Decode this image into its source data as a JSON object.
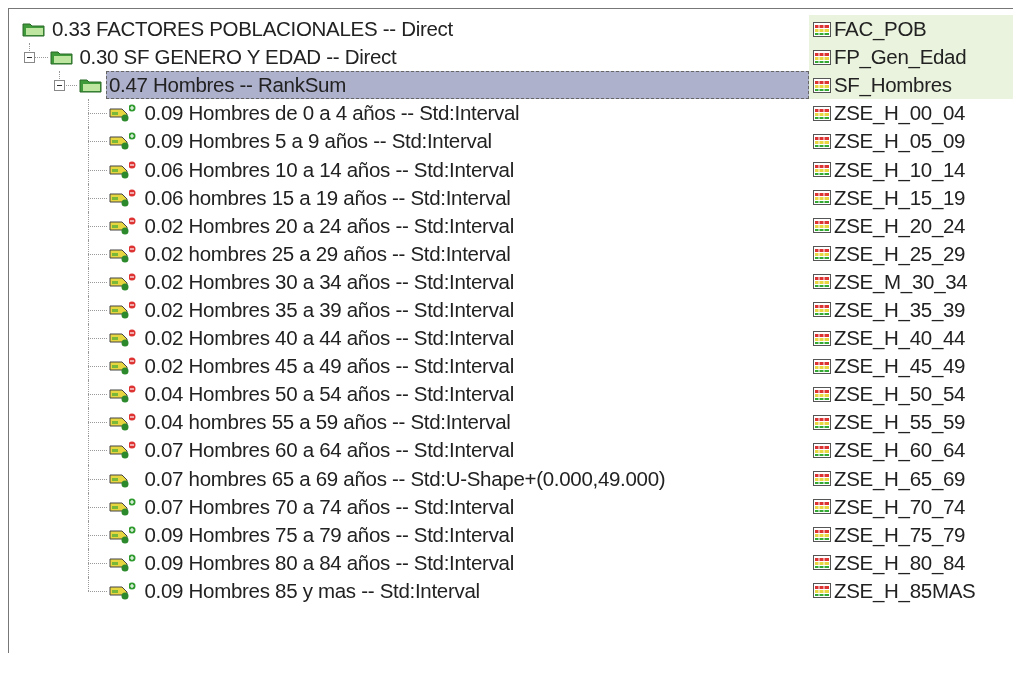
{
  "tree": {
    "label": "0.33 FACTORES POBLACIONALES -- Direct",
    "attribute": "FAC_POB",
    "kind": "group",
    "selected": false,
    "children": [
      {
        "label": "0.30 SF GENERO Y EDAD -- Direct",
        "attribute": "FP_Gen_Edad",
        "kind": "group",
        "selected": false,
        "expanded": true,
        "children": [
          {
            "label": "0.47 Hombres -- RankSum",
            "attribute": "SF_Hombres",
            "kind": "group",
            "selected": true,
            "expanded": true,
            "children": [
              {
                "label": "0.09 Hombres de 0 a 4 años -- Std:Interval",
                "attribute": "ZSE_H_00_04",
                "kind": "increasing",
                "selected": false
              },
              {
                "label": "0.09 Hombres 5 a 9 años -- Std:Interval",
                "attribute": "ZSE_H_05_09",
                "kind": "increasing",
                "selected": false
              },
              {
                "label": "0.06 Hombres 10 a 14 años -- Std:Interval",
                "attribute": "ZSE_H_10_14",
                "kind": "decreasing",
                "selected": false
              },
              {
                "label": "0.06 hombres 15 a 19 años -- Std:Interval",
                "attribute": "ZSE_H_15_19",
                "kind": "decreasing",
                "selected": false
              },
              {
                "label": "0.02 Hombres 20 a 24 años -- Std:Interval",
                "attribute": "ZSE_H_20_24",
                "kind": "decreasing",
                "selected": false
              },
              {
                "label": "0.02 hombres 25 a 29 años -- Std:Interval",
                "attribute": "ZSE_H_25_29",
                "kind": "decreasing",
                "selected": false
              },
              {
                "label": "0.02 Hombres 30 a 34 años -- Std:Interval",
                "attribute": "ZSE_M_30_34",
                "kind": "decreasing",
                "selected": false
              },
              {
                "label": "0.02 Hombres 35 a 39 años -- Std:Interval",
                "attribute": "ZSE_H_35_39",
                "kind": "decreasing",
                "selected": false
              },
              {
                "label": "0.02 Hombres 40 a 44 años -- Std:Interval",
                "attribute": "ZSE_H_40_44",
                "kind": "decreasing",
                "selected": false
              },
              {
                "label": "0.02 Hombres 45 a 49 años -- Std:Interval",
                "attribute": "ZSE_H_45_49",
                "kind": "decreasing",
                "selected": false
              },
              {
                "label": "0.04 Hombres 50 a 54 años -- Std:Interval",
                "attribute": "ZSE_H_50_54",
                "kind": "decreasing",
                "selected": false
              },
              {
                "label": "0.04 hombres 55 a 59 años -- Std:Interval",
                "attribute": "ZSE_H_55_59",
                "kind": "decreasing",
                "selected": false
              },
              {
                "label": "0.07 Hombres 60 a 64 años -- Std:Interval",
                "attribute": "ZSE_H_60_64",
                "kind": "decreasing",
                "selected": false
              },
              {
                "label": "0.07 hombres 65 a 69 años -- Std:U-Shape+(0.000,49.000)",
                "attribute": "ZSE_H_65_69",
                "kind": "plain",
                "selected": false
              },
              {
                "label": "0.07 Hombres 70 a 74 años -- Std:Interval",
                "attribute": "ZSE_H_70_74",
                "kind": "increasing",
                "selected": false
              },
              {
                "label": "0.09 Hombres 75 a 79 años -- Std:Interval",
                "attribute": "ZSE_H_75_79",
                "kind": "increasing",
                "selected": false
              },
              {
                "label": "0.09 Hombres 80 a 84 años -- Std:Interval",
                "attribute": "ZSE_H_80_84",
                "kind": "increasing",
                "selected": false
              },
              {
                "label": "0.09 Hombres 85 y mas -- Std:Interval",
                "attribute": "ZSE_H_85MAS",
                "kind": "increasing",
                "selected": false
              }
            ]
          }
        ]
      }
    ]
  }
}
